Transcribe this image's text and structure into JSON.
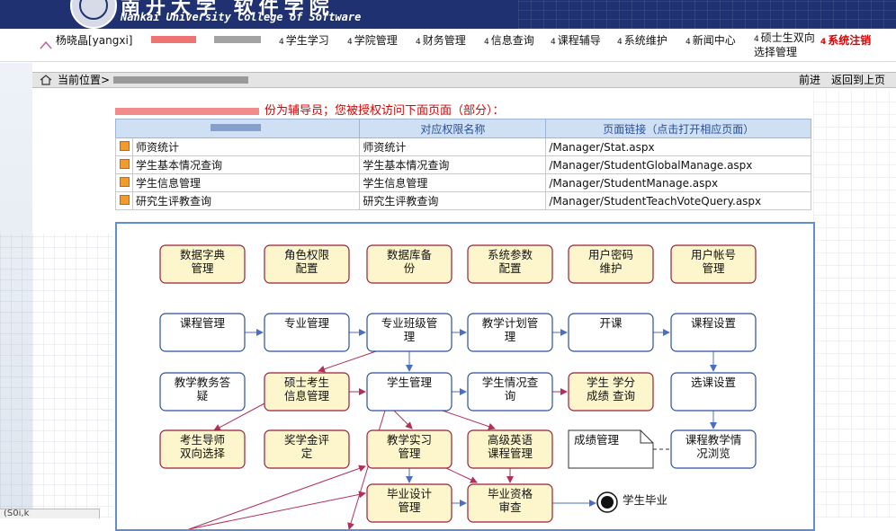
{
  "header": {
    "title_cn": "南开大学 软件学院",
    "title_en": "Nankai University College of Software"
  },
  "nav": {
    "user": "杨晓晶[yangxi]",
    "items": [
      {
        "label": "学生学习"
      },
      {
        "label": "学院管理"
      },
      {
        "label": "财务管理"
      },
      {
        "label": "信息查询"
      },
      {
        "label": "课程辅导"
      },
      {
        "label": "系统维护"
      },
      {
        "label": "新闻中心"
      },
      {
        "label": "硕士生双向",
        "label2": "选择管理"
      },
      {
        "label": "系统注销"
      }
    ]
  },
  "breadcrumb": {
    "prefix": "当前位置>",
    "forward": "前进",
    "back": "返回到上页"
  },
  "notice": "份为辅导员；您被授权访问下面页面（部分）：",
  "permissions": {
    "headers": [
      "",
      "对应权限名称",
      "页面链接（点击打开相应页面）"
    ],
    "rows": [
      {
        "name": "师资统计",
        "perm": "师资统计",
        "link": "/Manager/Stat.aspx"
      },
      {
        "name": "学生基本情况查询",
        "perm": "学生基本情况查询",
        "link": "/Manager/StudentGlobalManage.aspx"
      },
      {
        "name": "学生信息管理",
        "perm": "学生信息管理",
        "link": "/Manager/StudentManage.aspx"
      },
      {
        "name": "研究生评教查询",
        "perm": "研究生评教查询",
        "link": "/Manager/StudentTeachVoteQuery.aspx"
      }
    ]
  },
  "flow": {
    "row1": [
      "数据字典|管理",
      "角色权限|配置",
      "数据库备|份",
      "系统参数|配置",
      "用户密码|维护",
      "用户帐号|管理"
    ],
    "row2": [
      "课程管理",
      "专业管理",
      "专业班级管|理",
      "教学计划管|理",
      "开课",
      "课程设置"
    ],
    "row3": [
      "教学教务答|疑",
      "硕士考生|信息管理",
      "学生管理",
      "学生情况查|询",
      "学生 学分|成绩 查询",
      "选课设置"
    ],
    "row4": [
      "考生导师|双向选择",
      "奖学金评|定",
      "教学实习|管理",
      "高级英语|课程管理",
      "成绩管理",
      "课程教学情|况浏览"
    ],
    "row5": [
      "毕业设计|管理",
      "毕业资格|审查"
    ],
    "end": "学生毕业"
  },
  "status": "(S0i,k"
}
